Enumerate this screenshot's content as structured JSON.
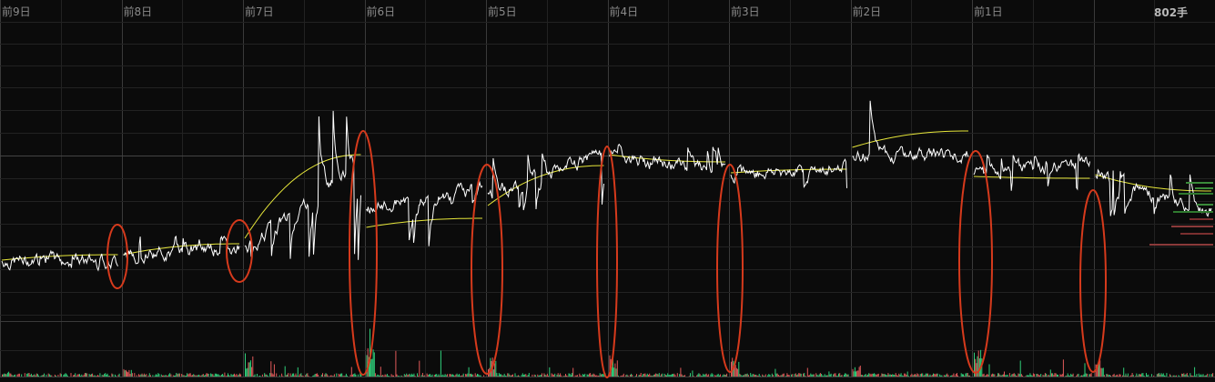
{
  "chart_data": {
    "type": "line",
    "price_panel": {
      "colors": {
        "price": "#ffffff",
        "average": "#e6e63a",
        "background": "#0b0b0b",
        "grid": "#2a2a2a",
        "marker": "#d63a1c"
      },
      "day_labels": [
        "前9日",
        "前8日",
        "前7日",
        "前6日",
        "前5日",
        "前4日",
        "前3日",
        "前2日",
        "前1日",
        ""
      ],
      "days": [
        {
          "open": 3,
          "close": 3,
          "high": 14,
          "low": 1,
          "avg_start": 4,
          "avg_end": 10
        },
        {
          "open": 10,
          "close": 18,
          "high": 30,
          "low": 6,
          "avg_start": 10,
          "avg_end": 22
        },
        {
          "open": 20,
          "close": 116,
          "high": 170,
          "low": 4,
          "avg_start": 28,
          "avg_end": 120
        },
        {
          "open": 60,
          "close": 84,
          "high": 70,
          "low": 18,
          "avg_start": 40,
          "avg_end": 50
        },
        {
          "open": 78,
          "close": 120,
          "high": 124,
          "low": 58,
          "avg_start": 64,
          "avg_end": 108
        },
        {
          "open": 118,
          "close": 102,
          "high": 132,
          "low": 96,
          "avg_start": 120,
          "avg_end": 112
        },
        {
          "open": 98,
          "close": 108,
          "high": 110,
          "low": 82,
          "avg_start": 100,
          "avg_end": 104
        },
        {
          "open": 118,
          "close": 122,
          "high": 180,
          "low": 116,
          "avg_start": 128,
          "avg_end": 146
        },
        {
          "open": 98,
          "close": 110,
          "high": 120,
          "low": 80,
          "avg_start": 96,
          "avg_end": 94
        },
        {
          "open": 96,
          "close": 56,
          "high": 104,
          "low": 52,
          "avg_start": 98,
          "avg_end": 80
        }
      ],
      "event_markers": [
        "前8日",
        "前7日",
        "前6日",
        "前5日",
        "前4日",
        "前3日",
        "前1日",
        ""
      ]
    },
    "volume_panel": {
      "unit_label": "802手",
      "colors": {
        "up": "#2fd07a",
        "down": "#e05a5a"
      },
      "day_peaks": [
        8,
        12,
        40,
        80,
        30,
        35,
        30,
        20,
        45,
        25
      ]
    }
  }
}
